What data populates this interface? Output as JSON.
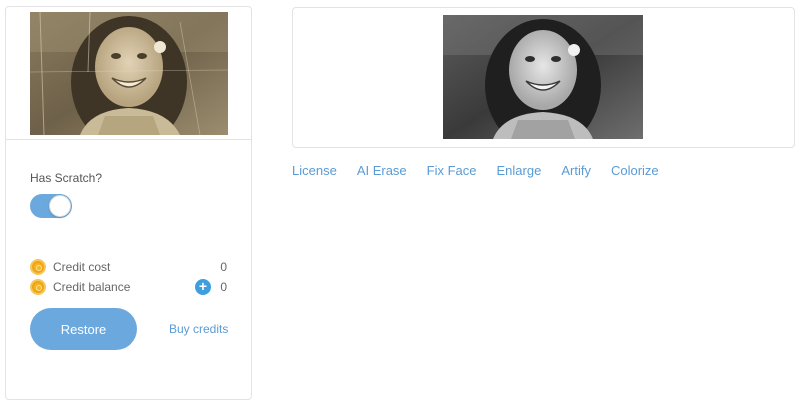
{
  "settings": {
    "scratch_label": "Has Scratch?",
    "scratch_enabled": true
  },
  "credits": {
    "cost_label": "Credit cost",
    "cost_value": "0",
    "balance_label": "Credit balance",
    "balance_value": "0",
    "add_symbol": "+"
  },
  "actions": {
    "restore_label": "Restore",
    "buy_label": "Buy credits"
  },
  "tools": [
    {
      "label": "License"
    },
    {
      "label": "AI Erase"
    },
    {
      "label": "Fix Face"
    },
    {
      "label": "Enlarge"
    },
    {
      "label": "Artify"
    },
    {
      "label": "Colorize"
    }
  ],
  "colors": {
    "accent": "#6aa8de",
    "link": "#5b9bd5",
    "coin": "#f5b423"
  }
}
